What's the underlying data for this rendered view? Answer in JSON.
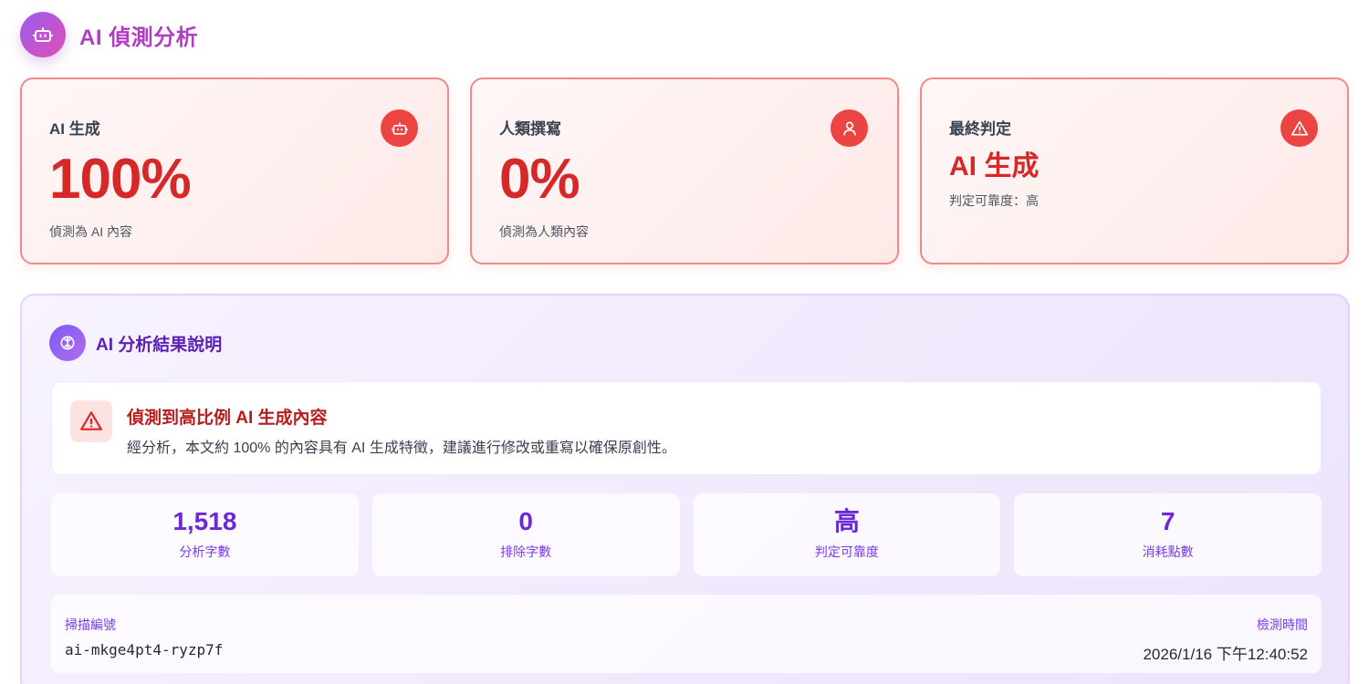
{
  "header": {
    "title": "AI 偵測分析",
    "icon": "robot-icon"
  },
  "cards": [
    {
      "label": "AI 生成",
      "value": "100%",
      "sub": "偵測為 AI 內容",
      "icon": "robot-icon"
    },
    {
      "label": "人類撰寫",
      "value": "0%",
      "sub": "偵測為人類內容",
      "icon": "user-icon"
    },
    {
      "label": "最終判定",
      "value": "AI 生成",
      "sub": "判定可靠度：高",
      "icon": "warning-icon"
    }
  ],
  "analysis": {
    "title": "AI 分析結果說明",
    "icon": "brain-icon",
    "alert": {
      "title": "偵測到高比例 AI 生成內容",
      "text": "經分析，本文約 100% 的內容具有 AI 生成特徵，建議進行修改或重寫以確保原創性。",
      "icon": "warning-icon"
    },
    "metrics": [
      {
        "value": "1,518",
        "label": "分析字數"
      },
      {
        "value": "0",
        "label": "排除字數"
      },
      {
        "value": "高",
        "label": "判定可靠度"
      },
      {
        "value": "7",
        "label": "消耗點數"
      }
    ],
    "scan": {
      "id_label": "掃描編號",
      "id": "ai-mkge4pt4-ryzp7f",
      "time_label": "檢測時間",
      "time": "2026/1/16 下午12:40:52"
    }
  },
  "colors": {
    "accent_purple": "#6d28d9",
    "danger_red": "#d62828",
    "header_title": "#b33cc4"
  }
}
